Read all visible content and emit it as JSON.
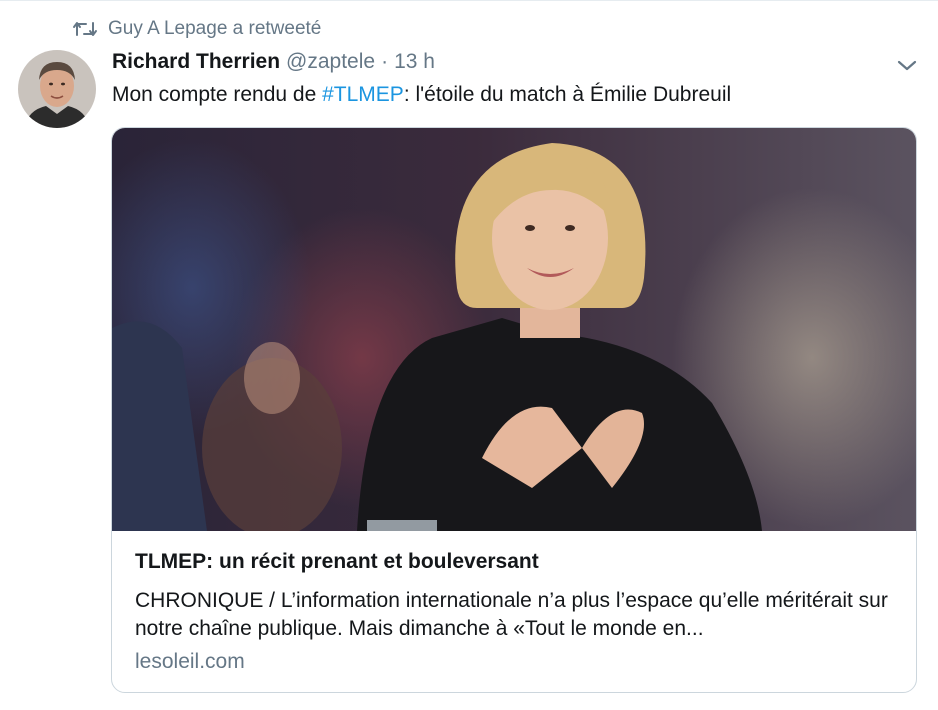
{
  "retweet": {
    "icon": "retweet-icon",
    "text": "Guy A Lepage a retweeté"
  },
  "author": {
    "name": "Richard Therrien",
    "handle": "@zaptele",
    "separator": "·",
    "time": "13 h"
  },
  "tweet": {
    "text_before": "Mon compte rendu de ",
    "hashtag": "#TLMEP",
    "text_after": ": l'étoile du match à Émilie Dubreuil"
  },
  "menu": {
    "icon": "chevron-down-icon"
  },
  "card": {
    "title": "TLMEP: un récit prenant et bouleversant",
    "description": "CHRONIQUE / L’information internationale n’a plus l’espace qu’elle méritérait sur notre chaîne publique. Mais dimanche à «Tout le monde en...",
    "domain": "lesoleil.com"
  },
  "colors": {
    "link": "#1b95e0",
    "secondary": "#657786",
    "border": "#ccd6dd"
  }
}
